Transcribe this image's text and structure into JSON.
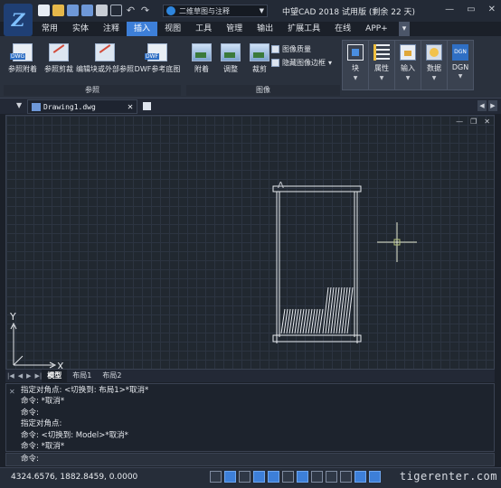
{
  "titlebar": {
    "logo_text": "Z",
    "workspace": "二维草图与注释",
    "app_title": "中望CAD 2018 试用版 (剩余 22 天)",
    "win_min": "—",
    "win_max": "▭",
    "win_close": "✕"
  },
  "tabs": [
    "常用",
    "实体",
    "注释",
    "插入",
    "视图",
    "工具",
    "管理",
    "输出",
    "扩展工具",
    "在线",
    "APP+"
  ],
  "active_tab": "插入",
  "tab_dropdown": "▾",
  "ribbon": {
    "reference": {
      "title": "参照",
      "buttons": [
        {
          "label": "参照附着",
          "tag": "DWG"
        },
        {
          "label": "参照剪裁",
          "tag": ""
        },
        {
          "label": "编辑块或外部参照",
          "tag": ""
        },
        {
          "label": "DWF参考底图",
          "tag": "DWF"
        }
      ]
    },
    "image": {
      "title": "图像",
      "buttons": [
        "附着",
        "调整",
        "裁剪"
      ],
      "options": [
        "图像质量",
        "隐藏图像边框"
      ]
    },
    "big": [
      {
        "label": "块",
        "icon": "block-icon"
      },
      {
        "label": "属性",
        "icon": "attribute-icon"
      },
      {
        "label": "输入",
        "icon": "import-icon"
      },
      {
        "label": "数据",
        "icon": "data-icon"
      },
      {
        "label": "DGN",
        "icon": "dgn-icon",
        "badge": "DGN"
      }
    ]
  },
  "filetab": {
    "name": "Drawing1.dwg",
    "close": "✕"
  },
  "drawing": {
    "ucs_y": "Y",
    "ucs_x": "X",
    "marker": "A"
  },
  "layout_tabs": [
    "模型",
    "布局1",
    "布局2"
  ],
  "active_layout": "模型",
  "command_history": [
    "指定对角点: <切换到: 布局1>*取消*",
    "命令: *取消*",
    "命令:",
    "指定对角点:",
    "命令: <切换到: Model>*取消*",
    "命令: *取消*"
  ],
  "command_prompt": "命令:",
  "status": {
    "coords": "4324.6576, 1882.8459, 0.0000",
    "watermark": "tigerenter.com"
  }
}
